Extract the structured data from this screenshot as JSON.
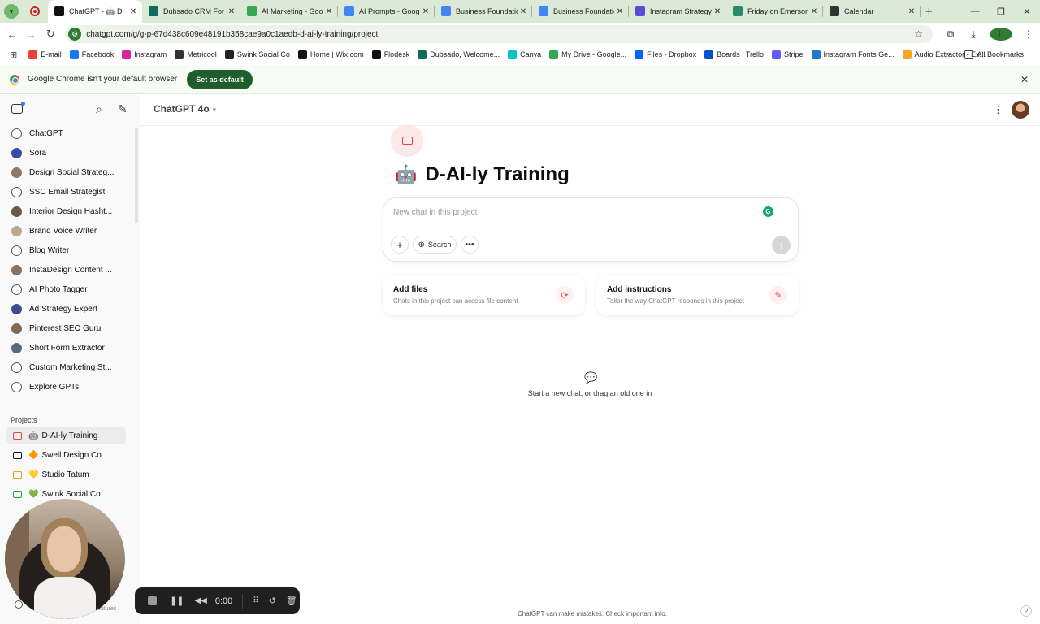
{
  "browser": {
    "tabs": [
      {
        "title": "ChatGPT - 🤖 D",
        "favicon_color": "#111111",
        "active": true
      },
      {
        "title": "Dubsado CRM For C",
        "favicon_color": "#0f6b5a"
      },
      {
        "title": "AI Marketing - Goo",
        "favicon_color": "#34a853"
      },
      {
        "title": "AI Prompts - Google",
        "favicon_color": "#4285f4"
      },
      {
        "title": "Business Foundatio",
        "favicon_color": "#4285f4"
      },
      {
        "title": "Business Foundatio",
        "favicon_color": "#4285f4"
      },
      {
        "title": "Instagram Strategy",
        "favicon_color": "#5b4bd6"
      },
      {
        "title": "Friday on Emerson C",
        "favicon_color": "#2a8a6f"
      },
      {
        "title": "Calendar",
        "favicon_color": "#333333"
      }
    ],
    "url": "chatgpt.com/g/g-p-67d438c609e48191b358cae9a0c1aedb-d-ai-ly-training/project",
    "profile_initial": "L",
    "bookmarks": [
      {
        "label": "E-mail",
        "color": "#ea4335"
      },
      {
        "label": "Facebook",
        "color": "#1877f2"
      },
      {
        "label": "Instagram",
        "color": "#d6249f"
      },
      {
        "label": "Metricool",
        "color": "#333333"
      },
      {
        "label": "Swink Social Co",
        "color": "#222222"
      },
      {
        "label": "Home | Wix.com",
        "color": "#111111"
      },
      {
        "label": "Flodesk",
        "color": "#111111"
      },
      {
        "label": "Dubsado, Welcome...",
        "color": "#0f6b5a"
      },
      {
        "label": "Canva",
        "color": "#00c4cc"
      },
      {
        "label": "My Drive - Google...",
        "color": "#34a853"
      },
      {
        "label": "Files - Dropbox",
        "color": "#0061ff"
      },
      {
        "label": "Boards | Trello",
        "color": "#0052cc"
      },
      {
        "label": "Stripe",
        "color": "#635bff"
      },
      {
        "label": "Instagram Fonts Ge...",
        "color": "#1f78d1"
      },
      {
        "label": "Audio Extractor - Ex...",
        "color": "#f6a623"
      }
    ],
    "bookmarks_more": "»",
    "all_bookmarks": "All Bookmarks",
    "banner_text": "Google Chrome isn't your default browser",
    "banner_button": "Set as default"
  },
  "sidebar": {
    "gpts": [
      {
        "label": "ChatGPT",
        "color": "#ffffff"
      },
      {
        "label": "Sora",
        "color": "#3a4aa8"
      },
      {
        "label": "Design Social Strateg...",
        "color": "#8a7b63"
      },
      {
        "label": "SSC Email Strategist",
        "color": "#ffffff"
      },
      {
        "label": "Interior Design Hasht...",
        "color": "#6a5a48"
      },
      {
        "label": "Brand Voice Writer",
        "color": "#b9a98e"
      },
      {
        "label": "Blog Writer",
        "color": "#ffffff"
      },
      {
        "label": "InstaDesign Content ...",
        "color": "#8c7158"
      },
      {
        "label": "AI Photo Tagger",
        "color": "#ffffff"
      },
      {
        "label": "Ad Strategy Expert",
        "color": "#3f4a8a"
      },
      {
        "label": "Pinterest SEO Guru",
        "color": "#7c6a5a"
      },
      {
        "label": "Short Form Extractor",
        "color": "#5a6a78"
      },
      {
        "label": "Custom Marketing St...",
        "color": "#ffffff"
      },
      {
        "label": "Explore GPTs",
        "color": "#ffffff"
      }
    ],
    "projects_heading": "Projects",
    "projects": [
      {
        "label": "D-AI-ly Training",
        "emoji": "🤖",
        "folder_color": "#e0474c",
        "selected": true
      },
      {
        "label": "Swell Design Co",
        "emoji": "🔶",
        "folder_color": "#0d0d0d"
      },
      {
        "label": "Studio Tatum",
        "emoji": "💛",
        "folder_color": "#e8a317"
      },
      {
        "label": "Swink Social Co",
        "emoji": "💚",
        "folder_color": "#1aa34a"
      }
    ],
    "peek_text": "features"
  },
  "main": {
    "model_label": "ChatGPT 4o",
    "project_emoji": "🤖",
    "project_title": "D-AI-ly Training",
    "composer_placeholder": "New chat in this project",
    "search_label": "Search",
    "cards": [
      {
        "title": "Add files",
        "subtitle": "Chats in this project can access file content"
      },
      {
        "title": "Add instructions",
        "subtitle": "Tailor the way ChatGPT responds in this project"
      }
    ],
    "empty_text": "Start a new chat, or drag an old one in",
    "footer": "ChatGPT can make mistakes. Check important info."
  },
  "recorder": {
    "time": "0:00"
  }
}
